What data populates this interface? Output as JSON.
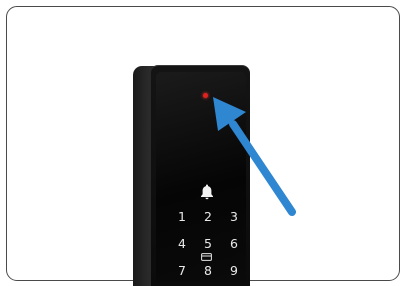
{
  "keypad": {
    "row1": [
      "1",
      "2",
      "3"
    ],
    "row2": [
      "4",
      "5",
      "6"
    ],
    "row3": [
      "7",
      "8",
      "9"
    ]
  },
  "icons": {
    "bell": "bell-icon",
    "card": "card-icon",
    "sensor": "sensor-indicator",
    "arrow": "pointer-arrow"
  },
  "colors": {
    "lock_body": "#0b0b0b",
    "sensor_red": "#e0221f",
    "arrow_blue": "#2f86d1",
    "key_text": "#e9e9e9"
  }
}
